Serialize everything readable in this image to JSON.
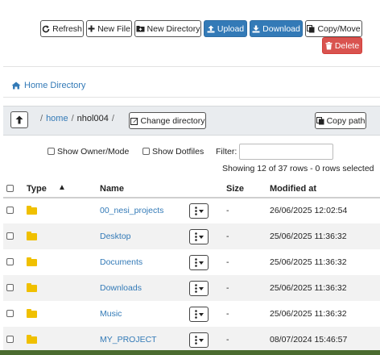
{
  "toolbar": {
    "refresh_label": "Refresh",
    "new_file_label": "New File",
    "new_directory_label": "New Directory",
    "upload_label": "Upload",
    "download_label": "Download",
    "copy_move_label": "Copy/Move",
    "delete_label": "Delete"
  },
  "nav": {
    "home_directory_label": "Home Directory"
  },
  "breadcrumb": {
    "sep1": "/",
    "home": "home",
    "sep2": "/",
    "user": "nhol004",
    "sep3": "/",
    "change_directory_label": "Change directory",
    "copy_path_label": "Copy path"
  },
  "options": {
    "show_owner_mode_label": "Show Owner/Mode",
    "show_dotfiles_label": "Show Dotfiles",
    "filter_label": "Filter:",
    "filter_value": "",
    "status_text": "Showing 12 of 37 rows - 0 rows selected"
  },
  "table": {
    "columns": {
      "type": "Type",
      "sort_indicator": "▲",
      "name": "Name",
      "size": "Size",
      "modified": "Modified at"
    },
    "rows": [
      {
        "name": "00_nesi_projects",
        "size": "-",
        "modified": "26/06/2025 12:02:54"
      },
      {
        "name": "Desktop",
        "size": "-",
        "modified": "25/06/2025 11:36:32"
      },
      {
        "name": "Documents",
        "size": "-",
        "modified": "25/06/2025 11:36:32"
      },
      {
        "name": "Downloads",
        "size": "-",
        "modified": "25/06/2025 11:36:32"
      },
      {
        "name": "Music",
        "size": "-",
        "modified": "25/06/2025 11:36:32"
      },
      {
        "name": "MY_PROJECT",
        "size": "-",
        "modified": "08/07/2024 15:46:57"
      }
    ]
  },
  "colors": {
    "primary": "#337ab7",
    "danger": "#d9534f",
    "folder": "#f0c000"
  }
}
